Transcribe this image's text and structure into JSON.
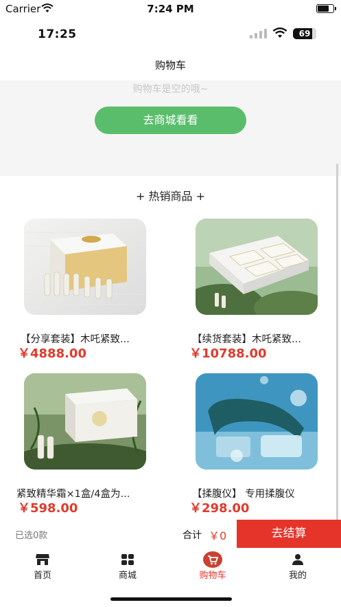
{
  "status_outer": {
    "carrier": "Carrier",
    "time": "7:24 PM"
  },
  "status_inner": {
    "time": "17:25",
    "battery": "69"
  },
  "nav": {
    "title": "购物车"
  },
  "empty_cart": {
    "message": "购物车是空的哦~",
    "button": "去商城看看"
  },
  "hot": {
    "title": "+ 热销商品 +"
  },
  "products": [
    {
      "name": "【分享套装】木吒紧致...",
      "price": "￥4888.00"
    },
    {
      "name": "【续货套装】木吒紧致...",
      "price": "￥10788.00"
    },
    {
      "name": "紧致精华霜×1盒/4盒为...",
      "price": "￥598.00"
    },
    {
      "name": "【揉腹仪】 专用揉腹仪",
      "price": "￥298.00"
    }
  ],
  "checkout": {
    "selected": "已选0款",
    "total_label": "合计",
    "total_amount": "￥0",
    "button": "去结算"
  },
  "tabbar": [
    {
      "label": "首页",
      "icon": "store-icon"
    },
    {
      "label": "商城",
      "icon": "grid-icon"
    },
    {
      "label": "购物车",
      "icon": "cart-icon"
    },
    {
      "label": "我的",
      "icon": "user-icon"
    }
  ],
  "colors": {
    "accent_red": "#e5342a",
    "green_button": "#5abd6c",
    "price_red": "#e03a2c"
  }
}
